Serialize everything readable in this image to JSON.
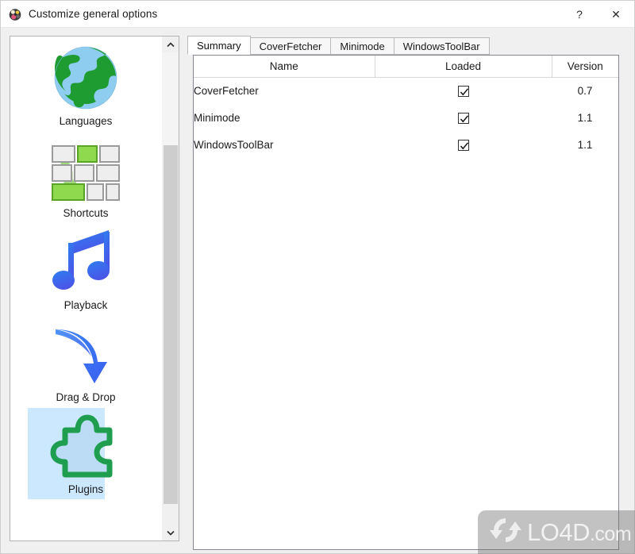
{
  "window": {
    "title": "Customize general options",
    "icon": "clementine-app-icon",
    "controls": [
      {
        "name": "help-button",
        "glyph": "?"
      },
      {
        "name": "close-button",
        "glyph": "✕"
      }
    ]
  },
  "sidebar": {
    "items": [
      {
        "label": "Languages",
        "icon": "globe-icon",
        "selected": false
      },
      {
        "label": "Shortcuts",
        "icon": "keyboard-icon",
        "selected": false
      },
      {
        "label": "Playback",
        "icon": "music-note-icon",
        "selected": false
      },
      {
        "label": "Drag & Drop",
        "icon": "curved-arrow-icon",
        "selected": false
      },
      {
        "label": "Plugins",
        "icon": "puzzle-piece-icon",
        "selected": true
      }
    ],
    "scrollbar": {
      "up_arrow": "chevron-up-icon",
      "down_arrow": "chevron-down-icon"
    }
  },
  "main": {
    "tabs": [
      {
        "label": "Summary",
        "active": true
      },
      {
        "label": "CoverFetcher",
        "active": false
      },
      {
        "label": "Minimode",
        "active": false
      },
      {
        "label": "WindowsToolBar",
        "active": false
      }
    ],
    "table": {
      "columns": [
        "Name",
        "Loaded",
        "Version"
      ],
      "rows": [
        {
          "name": "CoverFetcher",
          "loaded": true,
          "version": "0.7"
        },
        {
          "name": "Minimode",
          "loaded": true,
          "version": "1.1"
        },
        {
          "name": "WindowsToolBar",
          "loaded": true,
          "version": "1.1"
        }
      ]
    }
  },
  "watermark": {
    "text": "LO4D",
    "suffix": ".com",
    "icon": "refresh-circle-icon"
  },
  "colors": {
    "selection": "#cce8ff",
    "window_bg": "#f0f0f0",
    "panel_bg": "#ffffff",
    "green": "#1f9e50",
    "blue": "#3a7ff0"
  }
}
